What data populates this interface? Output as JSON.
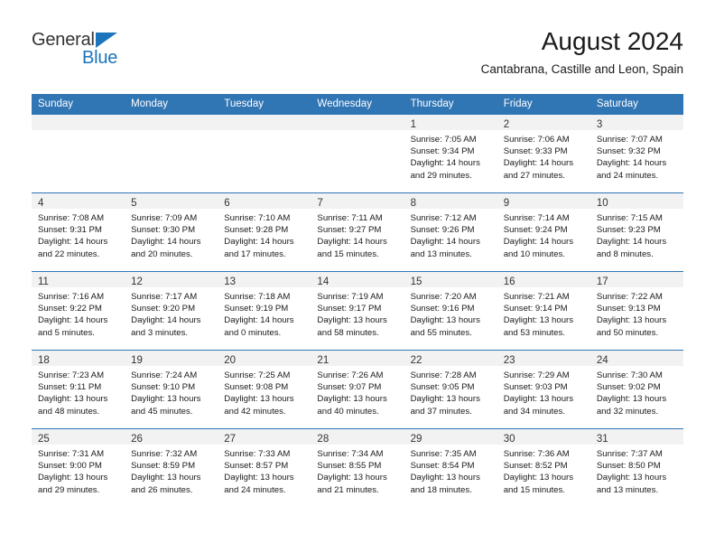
{
  "logo": {
    "word1": "General",
    "word2": "Blue",
    "triangle_color": "#1b74bc",
    "word1_color": "#333333"
  },
  "header": {
    "title": "August 2024",
    "subtitle": "Cantabrana, Castille and Leon, Spain"
  },
  "theme": {
    "header_blue": "#3075b4",
    "band_gray": "#f2f2f2"
  },
  "weekday_headers": [
    "Sunday",
    "Monday",
    "Tuesday",
    "Wednesday",
    "Thursday",
    "Friday",
    "Saturday"
  ],
  "weeks": [
    [
      {
        "day": "",
        "lines": []
      },
      {
        "day": "",
        "lines": []
      },
      {
        "day": "",
        "lines": []
      },
      {
        "day": "",
        "lines": []
      },
      {
        "day": "1",
        "lines": [
          "Sunrise: 7:05 AM",
          "Sunset: 9:34 PM",
          "Daylight: 14 hours",
          "and 29 minutes."
        ]
      },
      {
        "day": "2",
        "lines": [
          "Sunrise: 7:06 AM",
          "Sunset: 9:33 PM",
          "Daylight: 14 hours",
          "and 27 minutes."
        ]
      },
      {
        "day": "3",
        "lines": [
          "Sunrise: 7:07 AM",
          "Sunset: 9:32 PM",
          "Daylight: 14 hours",
          "and 24 minutes."
        ]
      }
    ],
    [
      {
        "day": "4",
        "lines": [
          "Sunrise: 7:08 AM",
          "Sunset: 9:31 PM",
          "Daylight: 14 hours",
          "and 22 minutes."
        ]
      },
      {
        "day": "5",
        "lines": [
          "Sunrise: 7:09 AM",
          "Sunset: 9:30 PM",
          "Daylight: 14 hours",
          "and 20 minutes."
        ]
      },
      {
        "day": "6",
        "lines": [
          "Sunrise: 7:10 AM",
          "Sunset: 9:28 PM",
          "Daylight: 14 hours",
          "and 17 minutes."
        ]
      },
      {
        "day": "7",
        "lines": [
          "Sunrise: 7:11 AM",
          "Sunset: 9:27 PM",
          "Daylight: 14 hours",
          "and 15 minutes."
        ]
      },
      {
        "day": "8",
        "lines": [
          "Sunrise: 7:12 AM",
          "Sunset: 9:26 PM",
          "Daylight: 14 hours",
          "and 13 minutes."
        ]
      },
      {
        "day": "9",
        "lines": [
          "Sunrise: 7:14 AM",
          "Sunset: 9:24 PM",
          "Daylight: 14 hours",
          "and 10 minutes."
        ]
      },
      {
        "day": "10",
        "lines": [
          "Sunrise: 7:15 AM",
          "Sunset: 9:23 PM",
          "Daylight: 14 hours",
          "and 8 minutes."
        ]
      }
    ],
    [
      {
        "day": "11",
        "lines": [
          "Sunrise: 7:16 AM",
          "Sunset: 9:22 PM",
          "Daylight: 14 hours",
          "and 5 minutes."
        ]
      },
      {
        "day": "12",
        "lines": [
          "Sunrise: 7:17 AM",
          "Sunset: 9:20 PM",
          "Daylight: 14 hours",
          "and 3 minutes."
        ]
      },
      {
        "day": "13",
        "lines": [
          "Sunrise: 7:18 AM",
          "Sunset: 9:19 PM",
          "Daylight: 14 hours",
          "and 0 minutes."
        ]
      },
      {
        "day": "14",
        "lines": [
          "Sunrise: 7:19 AM",
          "Sunset: 9:17 PM",
          "Daylight: 13 hours",
          "and 58 minutes."
        ]
      },
      {
        "day": "15",
        "lines": [
          "Sunrise: 7:20 AM",
          "Sunset: 9:16 PM",
          "Daylight: 13 hours",
          "and 55 minutes."
        ]
      },
      {
        "day": "16",
        "lines": [
          "Sunrise: 7:21 AM",
          "Sunset: 9:14 PM",
          "Daylight: 13 hours",
          "and 53 minutes."
        ]
      },
      {
        "day": "17",
        "lines": [
          "Sunrise: 7:22 AM",
          "Sunset: 9:13 PM",
          "Daylight: 13 hours",
          "and 50 minutes."
        ]
      }
    ],
    [
      {
        "day": "18",
        "lines": [
          "Sunrise: 7:23 AM",
          "Sunset: 9:11 PM",
          "Daylight: 13 hours",
          "and 48 minutes."
        ]
      },
      {
        "day": "19",
        "lines": [
          "Sunrise: 7:24 AM",
          "Sunset: 9:10 PM",
          "Daylight: 13 hours",
          "and 45 minutes."
        ]
      },
      {
        "day": "20",
        "lines": [
          "Sunrise: 7:25 AM",
          "Sunset: 9:08 PM",
          "Daylight: 13 hours",
          "and 42 minutes."
        ]
      },
      {
        "day": "21",
        "lines": [
          "Sunrise: 7:26 AM",
          "Sunset: 9:07 PM",
          "Daylight: 13 hours",
          "and 40 minutes."
        ]
      },
      {
        "day": "22",
        "lines": [
          "Sunrise: 7:28 AM",
          "Sunset: 9:05 PM",
          "Daylight: 13 hours",
          "and 37 minutes."
        ]
      },
      {
        "day": "23",
        "lines": [
          "Sunrise: 7:29 AM",
          "Sunset: 9:03 PM",
          "Daylight: 13 hours",
          "and 34 minutes."
        ]
      },
      {
        "day": "24",
        "lines": [
          "Sunrise: 7:30 AM",
          "Sunset: 9:02 PM",
          "Daylight: 13 hours",
          "and 32 minutes."
        ]
      }
    ],
    [
      {
        "day": "25",
        "lines": [
          "Sunrise: 7:31 AM",
          "Sunset: 9:00 PM",
          "Daylight: 13 hours",
          "and 29 minutes."
        ]
      },
      {
        "day": "26",
        "lines": [
          "Sunrise: 7:32 AM",
          "Sunset: 8:59 PM",
          "Daylight: 13 hours",
          "and 26 minutes."
        ]
      },
      {
        "day": "27",
        "lines": [
          "Sunrise: 7:33 AM",
          "Sunset: 8:57 PM",
          "Daylight: 13 hours",
          "and 24 minutes."
        ]
      },
      {
        "day": "28",
        "lines": [
          "Sunrise: 7:34 AM",
          "Sunset: 8:55 PM",
          "Daylight: 13 hours",
          "and 21 minutes."
        ]
      },
      {
        "day": "29",
        "lines": [
          "Sunrise: 7:35 AM",
          "Sunset: 8:54 PM",
          "Daylight: 13 hours",
          "and 18 minutes."
        ]
      },
      {
        "day": "30",
        "lines": [
          "Sunrise: 7:36 AM",
          "Sunset: 8:52 PM",
          "Daylight: 13 hours",
          "and 15 minutes."
        ]
      },
      {
        "day": "31",
        "lines": [
          "Sunrise: 7:37 AM",
          "Sunset: 8:50 PM",
          "Daylight: 13 hours",
          "and 13 minutes."
        ]
      }
    ]
  ]
}
